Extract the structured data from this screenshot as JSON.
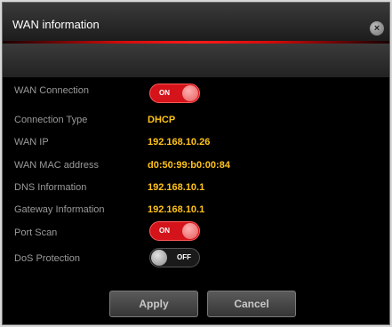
{
  "dialog": {
    "title": "WAN information",
    "close_icon": "close-icon"
  },
  "fields": {
    "wan_connection": {
      "label": "WAN Connection",
      "state": "ON"
    },
    "connection_type": {
      "label": "Connection Type",
      "value": "DHCP"
    },
    "wan_ip": {
      "label": "WAN IP",
      "value": "192.168.10.26"
    },
    "wan_mac": {
      "label": "WAN MAC address",
      "value": "d0:50:99:b0:00:84"
    },
    "dns": {
      "label": "DNS Information",
      "value": "192.168.10.1"
    },
    "gateway": {
      "label": "Gateway Information",
      "value": "192.168.10.1"
    },
    "port_scan": {
      "label": "Port Scan",
      "state": "ON"
    },
    "dos_protection": {
      "label": "DoS Protection",
      "state": "OFF"
    }
  },
  "buttons": {
    "apply": "Apply",
    "cancel": "Cancel"
  },
  "colors": {
    "accent_red": "#d4141a",
    "value_yellow": "#ffc21a",
    "label_gray": "#9a9a9a"
  }
}
